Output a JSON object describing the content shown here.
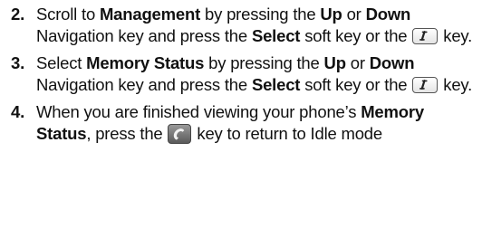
{
  "steps": [
    {
      "number": "2.",
      "t1": "Scroll to ",
      "b1": "Management",
      "t2": " by pressing the ",
      "b2": "Up",
      "t3": " or ",
      "b3": "Down",
      "t4": " Navigation key and press the ",
      "b4": "Select",
      "t5": " soft key or the ",
      "icon": "info-key-icon",
      "t6": " key."
    },
    {
      "number": "3.",
      "t1": "Select ",
      "b1": "Memory Status",
      "t2": " by pressing the ",
      "b2": "Up",
      "t3": " or ",
      "b3": "Down",
      "t4": " Navigation key and press the ",
      "b4": "Select",
      "t5": " soft key or the ",
      "icon": "info-key-icon",
      "t6": " key."
    },
    {
      "number": "4.",
      "t1": "When you are finished viewing your phone’s ",
      "b1": "Memory Status",
      "t2": ", press the ",
      "icon": "end-key-icon",
      "t3": " key to return to Idle mode"
    }
  ]
}
